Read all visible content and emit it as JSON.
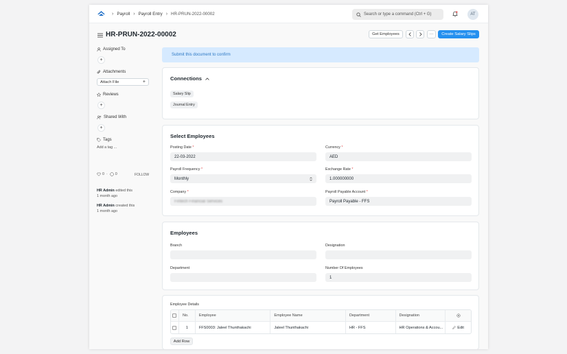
{
  "navbar": {
    "breadcrumbs": [
      "Payroll",
      "Payroll Entry",
      "HR-PRUN-2022-00002"
    ],
    "search_placeholder": "Search or type a command (Ctrl + G)",
    "avatar_initials": "AT"
  },
  "page": {
    "title": "HR-PRUN-2022-00002",
    "get_employees_label": "Get Employees",
    "more_label": "···",
    "create_salary_slips_label": "Create Salary Slips"
  },
  "sidebar": {
    "assigned_to": "Assigned To",
    "attachments": "Attachments",
    "attach_file": "Attach File",
    "reviews": "Reviews",
    "shared_with": "Shared With",
    "tags": "Tags",
    "add_tag": "Add a tag ...",
    "likes_count": "0",
    "comments_count": "0",
    "follow_label": "FOLLOW",
    "activity": [
      {
        "user": "HR Admin",
        "action": "edited this",
        "time": "1 month ago"
      },
      {
        "user": "HR Admin",
        "action": "created this",
        "time": "1 month ago"
      }
    ]
  },
  "alert": {
    "text": "Submit this document to confirm"
  },
  "connections": {
    "title": "Connections",
    "links": [
      "Salary Slip",
      "Journal Entry"
    ]
  },
  "select_employees": {
    "title": "Select Employees",
    "posting_date_label": "Posting Date",
    "posting_date": "22-03-2022",
    "payroll_frequency_label": "Payroll Frequency",
    "payroll_frequency": "Monthly",
    "company_label": "Company",
    "company": "Fintech Financial Services",
    "currency_label": "Currency",
    "currency": "AED",
    "exchange_rate_label": "Exchange Rate",
    "exchange_rate": "1.000000000",
    "payroll_payable_account_label": "Payroll Payable Account",
    "payroll_payable_account": "Payroll Payable - FFS"
  },
  "employees": {
    "title": "Employees",
    "branch_label": "Branch",
    "branch": "",
    "designation_label": "Designation",
    "designation": "",
    "department_label": "Department",
    "department": "",
    "number_of_employees_label": "Number Of Employees",
    "number_of_employees": "1",
    "employee_details_label": "Employee Details",
    "table_headers": [
      "No.",
      "Employee",
      "Employee Name",
      "Department",
      "Designation"
    ],
    "rows": [
      {
        "no": "1",
        "employee": "FFS0003: Jaleel Thunthakachi",
        "employee_name": "Jaleel Thunthakachi",
        "department": "HR - FFS",
        "designation": "HR Operations & Accou...",
        "edit": "Edit"
      }
    ],
    "add_row_label": "Add Row"
  },
  "icons": [
    "app-logo-icon",
    "search-icon",
    "bell-icon",
    "hamburger-icon",
    "chevron-left-icon",
    "chevron-right-icon",
    "user-icon",
    "paperclip-icon",
    "star-icon",
    "users-icon",
    "tag-icon",
    "heart-icon",
    "comment-icon",
    "chevron-up-icon",
    "select-arrows-icon",
    "gear-icon",
    "pencil-icon"
  ],
  "colors": {
    "primary": "#2490ef",
    "alert_bg": "#d6eaff",
    "alert_text": "#2d79c4",
    "required": "#e24c4c"
  }
}
